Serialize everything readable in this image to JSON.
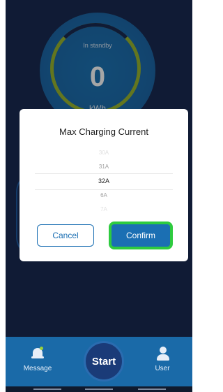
{
  "gauge": {
    "status": "In standby",
    "value": "0",
    "unit": "kWh"
  },
  "dialog": {
    "title": "Max Charging Current",
    "picker_options": [
      "30A",
      "31A",
      "32A",
      "6A",
      "7A"
    ],
    "selected": "32A",
    "cancel_label": "Cancel",
    "confirm_label": "Confirm"
  },
  "tabbar": {
    "message_label": "Message",
    "start_label": "Start",
    "user_label": "User"
  },
  "colors": {
    "background": "#1a2a52",
    "accent": "#1b6fb3",
    "highlight": "#2ecb3f"
  }
}
